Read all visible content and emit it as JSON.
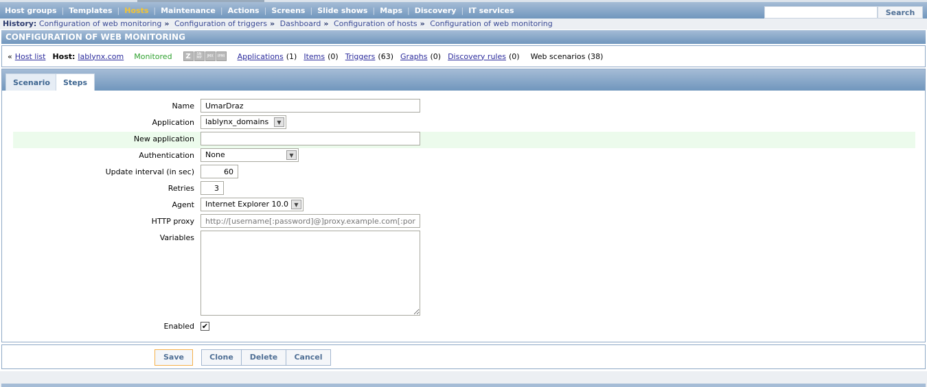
{
  "nav": {
    "items": [
      "Host groups",
      "Templates",
      "Hosts",
      "Maintenance",
      "Actions",
      "Screens",
      "Slide shows",
      "Maps",
      "Discovery",
      "IT services"
    ],
    "active": "Hosts",
    "search_button": "Search",
    "search_value": ""
  },
  "history": {
    "label": "History:",
    "items": [
      "Configuration of web monitoring",
      "Configuration of triggers",
      "Dashboard",
      "Configuration of hosts",
      "Configuration of web monitoring"
    ]
  },
  "header": {
    "title": "CONFIGURATION OF WEB MONITORING"
  },
  "hostbar": {
    "back": "Host list",
    "host_label": "Host:",
    "host": "lablynx.com",
    "status": "Monitored",
    "availability_icons": [
      "Z",
      "SNMP",
      "JMX",
      "IPMI"
    ],
    "links": [
      {
        "label": "Applications",
        "count": "(1)"
      },
      {
        "label": "Items",
        "count": "(0)"
      },
      {
        "label": "Triggers",
        "count": "(63)"
      },
      {
        "label": "Graphs",
        "count": "(0)"
      },
      {
        "label": "Discovery rules",
        "count": "(0)"
      }
    ],
    "current": "Web scenarios (38)"
  },
  "tabs": [
    "Scenario",
    "Steps"
  ],
  "form": {
    "name_label": "Name",
    "name": "UmarDraz",
    "application_label": "Application",
    "application": "lablynx_domains",
    "new_application_label": "New application",
    "new_application": "",
    "authentication_label": "Authentication",
    "authentication": "None",
    "interval_label": "Update interval (in sec)",
    "interval": "60",
    "retries_label": "Retries",
    "retries": "3",
    "agent_label": "Agent",
    "agent": "Internet Explorer 10.0",
    "proxy_label": "HTTP proxy",
    "proxy_placeholder": "http://[username[:password]@]proxy.example.com[:port]",
    "variables_label": "Variables",
    "variables": "",
    "enabled_label": "Enabled",
    "enabled": true
  },
  "buttons": {
    "save": "Save",
    "clone": "Clone",
    "delete": "Delete",
    "cancel": "Cancel"
  },
  "colors": {
    "accent": "#7096bd",
    "active_nav": "#f5c431",
    "monitored": "#2ca02c"
  }
}
